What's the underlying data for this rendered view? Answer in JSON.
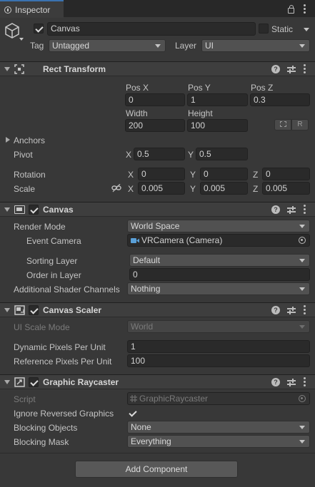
{
  "tab": {
    "title": "Inspector"
  },
  "object": {
    "name": "Canvas",
    "active": true,
    "static_label": "Static",
    "static": false
  },
  "tag": {
    "label": "Tag",
    "value": "Untagged"
  },
  "layer": {
    "label": "Layer",
    "value": "UI"
  },
  "rect_transform": {
    "title": "Rect Transform",
    "pos_x_label": "Pos X",
    "pos_y_label": "Pos Y",
    "pos_z_label": "Pos Z",
    "pos_x": "0",
    "pos_y": "1",
    "pos_z": "0.3",
    "width_label": "Width",
    "height_label": "Height",
    "width": "200",
    "height": "100",
    "raw_button": "R",
    "anchors_label": "Anchors",
    "pivot_label": "Pivot",
    "pivot_x": "0.5",
    "pivot_y": "0.5",
    "rotation_label": "Rotation",
    "rot_x": "0",
    "rot_y": "0",
    "rot_z": "0",
    "scale_label": "Scale",
    "scale_x": "0.005",
    "scale_y": "0.005",
    "scale_z": "0.005",
    "x": "X",
    "y": "Y",
    "z": "Z"
  },
  "canvas": {
    "title": "Canvas",
    "enabled": true,
    "render_mode_label": "Render Mode",
    "render_mode": "World Space",
    "event_camera_label": "Event Camera",
    "event_camera": "VRCamera (Camera)",
    "sorting_layer_label": "Sorting Layer",
    "sorting_layer": "Default",
    "order_label": "Order in Layer",
    "order": "0",
    "shader_channels_label": "Additional Shader Channels",
    "shader_channels": "Nothing"
  },
  "canvas_scaler": {
    "title": "Canvas Scaler",
    "enabled": true,
    "ui_scale_mode_label": "UI Scale Mode",
    "ui_scale_mode": "World",
    "dynamic_ppu_label": "Dynamic Pixels Per Unit",
    "dynamic_ppu": "1",
    "reference_ppu_label": "Reference Pixels Per Unit",
    "reference_ppu": "100"
  },
  "graphic_raycaster": {
    "title": "Graphic Raycaster",
    "enabled": true,
    "script_label": "Script",
    "script": "GraphicRaycaster",
    "ignore_reversed_label": "Ignore Reversed Graphics",
    "ignore_reversed": true,
    "blocking_objects_label": "Blocking Objects",
    "blocking_objects": "None",
    "blocking_mask_label": "Blocking Mask",
    "blocking_mask": "Everything"
  },
  "add_component_label": "Add Component",
  "colors": {
    "accent": "#3a72b0",
    "background": "#383838",
    "header": "#3e3e3e",
    "field": "#2a2a2a"
  },
  "icons": [
    "info-icon",
    "lock-icon",
    "kebab-icon",
    "gameobject-cube-icon",
    "rect-transform-icon",
    "canvas-icon",
    "canvas-scaler-icon",
    "graphic-raycaster-icon",
    "help-icon",
    "presets-icon",
    "link-icon",
    "camera-icon",
    "object-picker-icon",
    "blueprint-icon",
    "raw-edit-icon"
  ]
}
